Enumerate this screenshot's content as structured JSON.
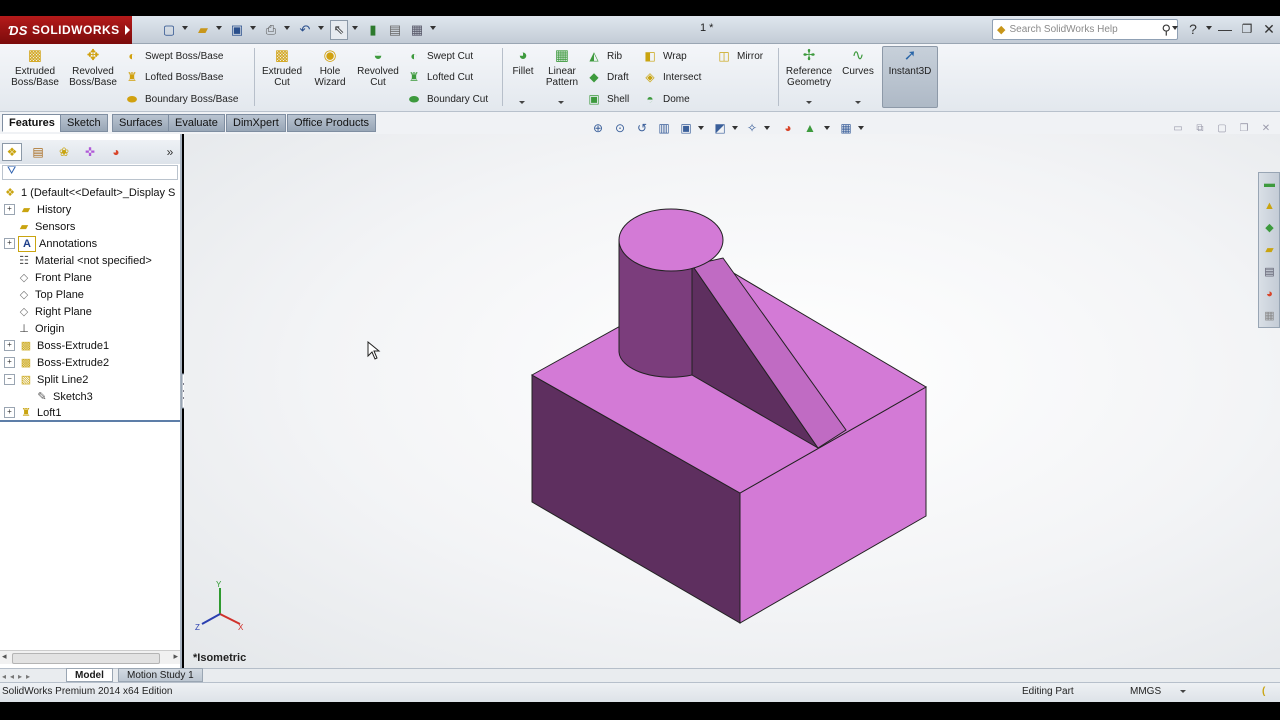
{
  "app": {
    "brand": "SOLIDWORKS",
    "doc_title": "1 *"
  },
  "help_search": {
    "placeholder": "Search SolidWorks Help"
  },
  "commands": {
    "extruded_boss": "Extruded Boss/Base",
    "revolved_boss": "Revolved Boss/Base",
    "swept_boss": "Swept Boss/Base",
    "lofted_boss": "Lofted Boss/Base",
    "boundary_boss": "Boundary Boss/Base",
    "extruded_cut": "Extruded Cut",
    "hole_wizard": "Hole Wizard",
    "revolved_cut": "Revolved Cut",
    "swept_cut": "Swept Cut",
    "lofted_cut": "Lofted Cut",
    "boundary_cut": "Boundary Cut",
    "fillet": "Fillet",
    "linear_pattern": "Linear Pattern",
    "rib": "Rib",
    "draft": "Draft",
    "shell": "Shell",
    "wrap": "Wrap",
    "intersect": "Intersect",
    "dome": "Dome",
    "mirror": "Mirror",
    "reference_geometry": "Reference Geometry",
    "curves": "Curves",
    "instant3d": "Instant3D"
  },
  "tabs": [
    "Features",
    "Sketch",
    "Surfaces",
    "Evaluate",
    "DimXpert",
    "Office Products"
  ],
  "tree": {
    "root": "1 (Default<<Default>_Display S",
    "items": [
      "History",
      "Sensors",
      "Annotations",
      "Material <not specified>",
      "Front Plane",
      "Top Plane",
      "Right Plane",
      "Origin",
      "Boss-Extrude1",
      "Boss-Extrude2",
      "Split Line2",
      "Sketch3",
      "Loft1"
    ]
  },
  "viewport": {
    "view_name": "*Isometric",
    "part_color": "#d37ad6"
  },
  "bottom_tabs": [
    "Model",
    "Motion Study 1"
  ],
  "status": {
    "edition": "SolidWorks Premium 2014 x64 Edition",
    "mode": "Editing Part",
    "units": "MMGS"
  }
}
